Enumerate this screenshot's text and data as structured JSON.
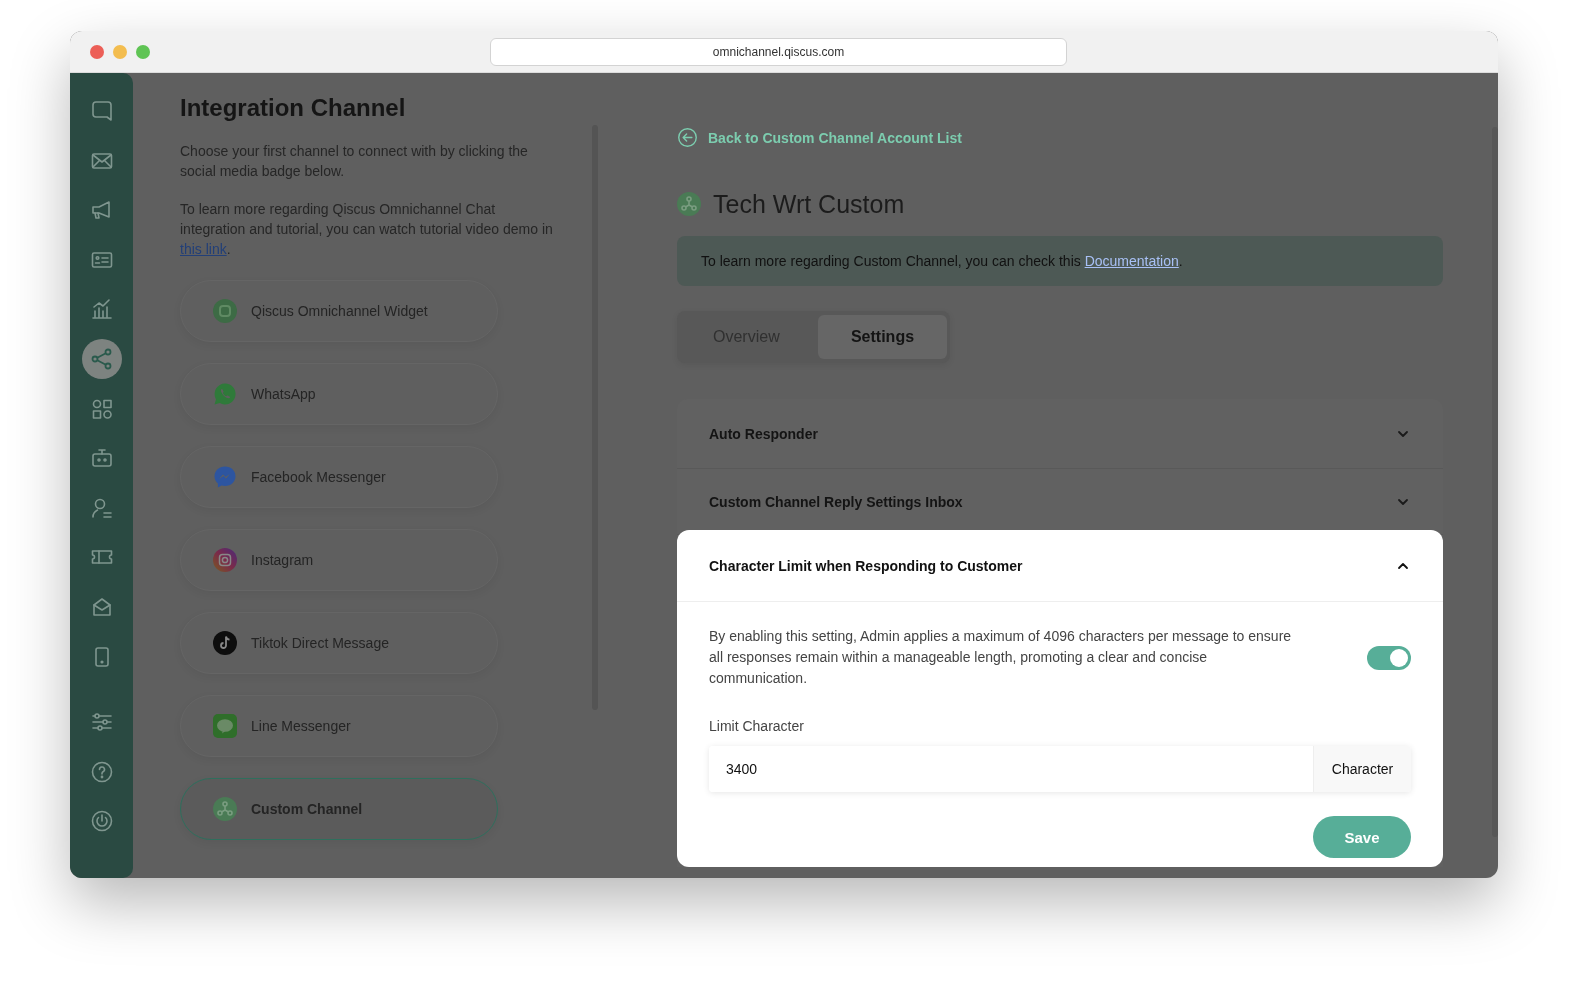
{
  "browser": {
    "url": "omnichannel.qiscus.com"
  },
  "nav": [
    {
      "kind": "chat",
      "selected": false
    },
    {
      "kind": "mail",
      "selected": false
    },
    {
      "kind": "megaphone",
      "selected": false
    },
    {
      "kind": "card",
      "selected": false
    },
    {
      "kind": "chart",
      "selected": false
    },
    {
      "kind": "share",
      "selected": true
    },
    {
      "kind": "grid",
      "selected": false
    },
    {
      "kind": "robot",
      "selected": false
    },
    {
      "kind": "user",
      "selected": false
    },
    {
      "kind": "ticket",
      "selected": false
    },
    {
      "kind": "inbox",
      "selected": false
    },
    {
      "kind": "mobile",
      "selected": false
    },
    {
      "kind": "sliders",
      "selected": false
    },
    {
      "kind": "help",
      "selected": false
    },
    {
      "kind": "power",
      "selected": false
    }
  ],
  "integration": {
    "title": "Integration Channel",
    "description": "Choose your first channel to connect with by clicking the social media badge below.",
    "help": {
      "text": "To learn more regarding Qiscus Omnichannel Chat integration and tutorial, you can watch tutorial video demo in",
      "link": "this link",
      "after": "."
    }
  },
  "channels": [
    {
      "name": "Qiscus Omnichannel Widget",
      "kind": "widget",
      "selected": false
    },
    {
      "name": "WhatsApp",
      "kind": "whatsapp",
      "selected": false
    },
    {
      "name": "Facebook Messenger",
      "kind": "messenger",
      "selected": false
    },
    {
      "name": "Instagram",
      "kind": "instagram",
      "selected": false
    },
    {
      "name": "Tiktok Direct Message",
      "kind": "tiktok",
      "selected": false
    },
    {
      "name": "Line Messenger",
      "kind": "line",
      "selected": false
    },
    {
      "name": "Custom Channel",
      "kind": "custom",
      "selected": true
    }
  ],
  "back_link": "Back to Custom Channel Account List",
  "account": {
    "name": "Tech Wrt Custom"
  },
  "notice": {
    "text": "To learn more regarding Custom Channel, you can check this",
    "link": "Documentation",
    "after": "."
  },
  "tabs": [
    {
      "label": "Overview",
      "selected": false
    },
    {
      "label": "Settings",
      "selected": true
    }
  ],
  "sections": [
    {
      "title": "Auto Responder",
      "expanded": false,
      "highlighted": false
    },
    {
      "title": "Custom Channel Reply Settings Inbox",
      "expanded": false,
      "highlighted": false
    },
    {
      "title": "Character Limit when Responding to Customer",
      "expanded": true,
      "highlighted": true,
      "description": "By enabling this setting, Admin applies a maximum of 4096 characters per message to ensure all responses remain within a manageable length, promoting a clear and concise communication.",
      "toggle": {
        "on": true
      },
      "field": {
        "label": "Limit Character",
        "value": "3400",
        "suffix": "Character"
      },
      "button": "Save"
    }
  ]
}
